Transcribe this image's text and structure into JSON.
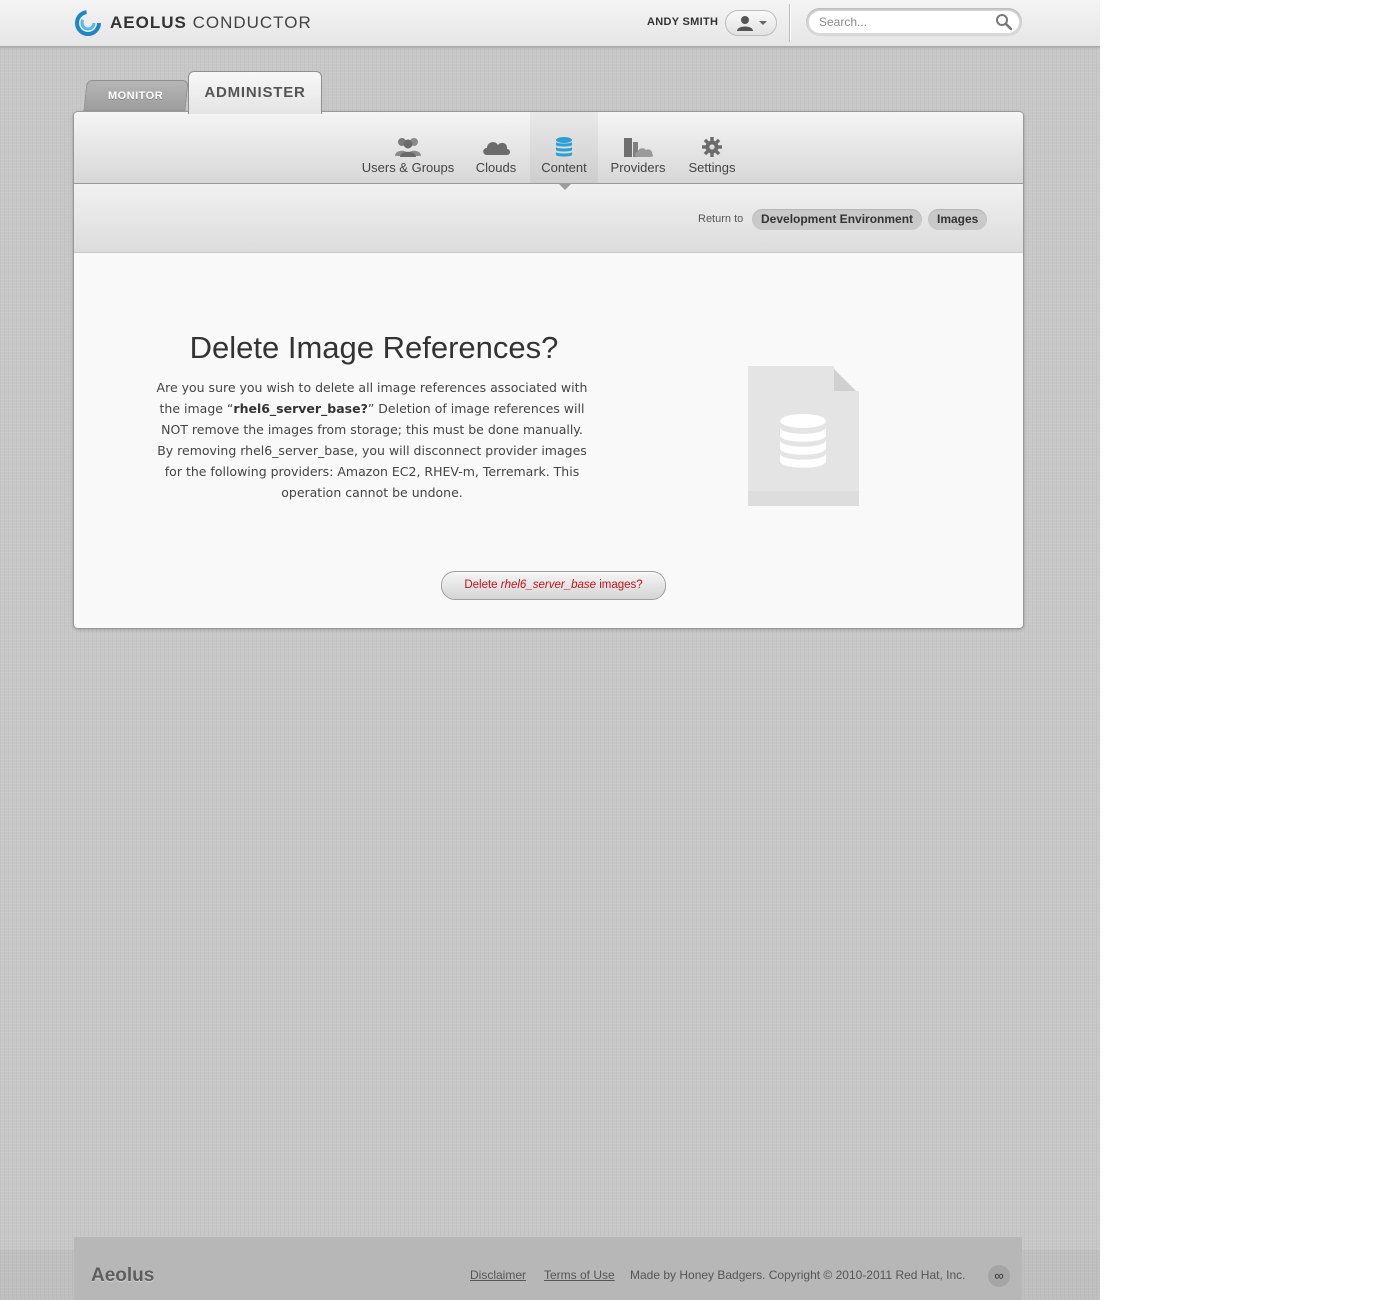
{
  "header": {
    "brand_bold": "AEOLUS",
    "brand_light": "CONDUCTOR",
    "user_name": "ANDY SMITH",
    "search_placeholder": "Search..."
  },
  "tabs": [
    {
      "label": "MONITOR",
      "active": false
    },
    {
      "label": "ADMINISTER",
      "active": true
    }
  ],
  "subnav": {
    "items": [
      {
        "label": "Users & Groups",
        "icon": "users-icon",
        "active": false
      },
      {
        "label": "Clouds",
        "icon": "cloud-icon",
        "active": false
      },
      {
        "label": "Content",
        "icon": "database-icon",
        "active": true
      },
      {
        "label": "Providers",
        "icon": "providers-icon",
        "active": false
      },
      {
        "label": "Settings",
        "icon": "gear-icon",
        "active": false
      }
    ]
  },
  "breadcrumb": {
    "return_label": "Return to",
    "items": [
      "Development Environment",
      "Images"
    ]
  },
  "dialog": {
    "title": "Delete Image References?",
    "body_intro": "Are you sure you wish to delete all image references associated with the image “",
    "image_name": "rhel6_server_base?",
    "body_rest": "” Deletion of image references will NOT remove the images from storage; this must be done manually. By removing rhel6_server_base, you will disconnect provider images for the following providers: Amazon EC2, RHEV-m, Terremark. This operation cannot be undone.",
    "button_prefix": "Delete ",
    "button_name": "rhel6_server_base",
    "button_suffix": " images?",
    "illustration_icon": "database-document-icon"
  },
  "footer": {
    "brand": "Aeolus",
    "links": [
      "Disclaimer",
      "Terms of Use"
    ],
    "copyright": "Made by Honey Badgers. Copyright © 2010-2011 Red Hat, Inc.",
    "badge": "∞"
  },
  "colors": {
    "accent_blue": "#2a9fd6",
    "danger_red": "#c1121b",
    "background_gray": "#c7c7c7"
  }
}
